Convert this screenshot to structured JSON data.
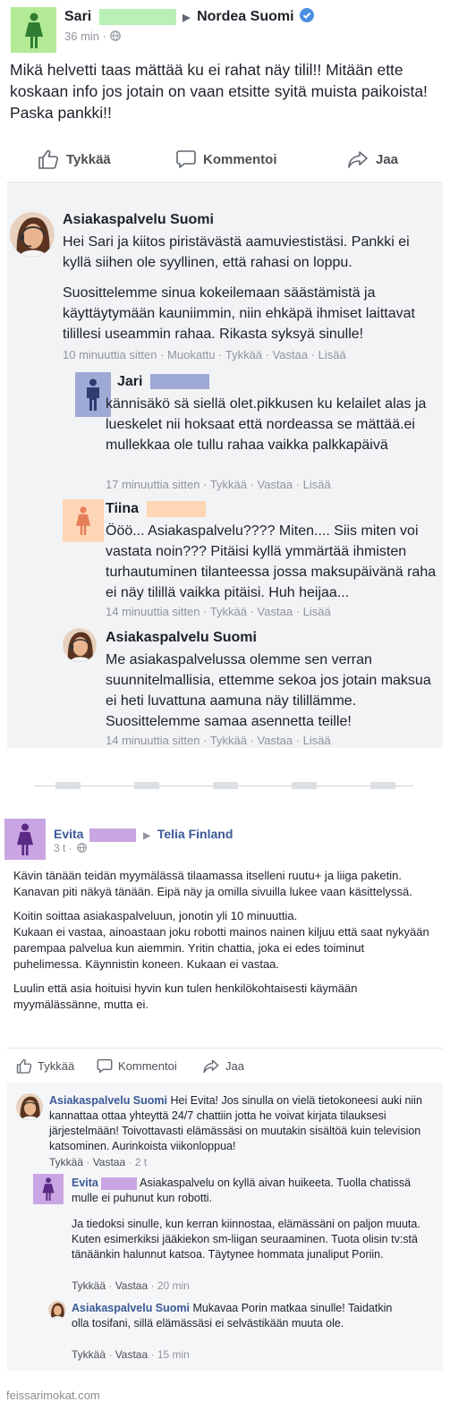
{
  "post1": {
    "author": "Sari",
    "page": "Nordea Suomi",
    "time": "36 min",
    "text": "Mikä helvetti taas mättää ku ei rahat näy tilil!! Mitään ette koskaan info jos jotain on vaan etsitte syitä muista paikoista! Paska pankki!!",
    "actions": {
      "like": "Tykkää",
      "comment": "Kommentoi",
      "share": "Jaa"
    },
    "comments": [
      {
        "author": "Asiakaspalvelu Suomi",
        "text1": "Hei Sari ja kiitos piristävästä aamuviestistäsi. Pankki ei kyllä siihen ole syyllinen, että rahasi on loppu.",
        "text2": "Suosittelemme sinua kokeilemaan säästämistä ja käyttäytymään kauniimmin, niin ehkäpä ihmiset laittavat tilillesi useammin rahaa. Rikasta syksyä sinulle!",
        "meta": "10 minuuttia sitten · Muokattu · Tykkää · Vastaa · Lisää"
      },
      {
        "author": "Jari",
        "text": "kännisäkö sä siellä olet.pikkusen ku kelailet alas ja lueskelet nii hoksaat että nordeassa se mättää.ei mullekkaa ole tullu rahaa vaikka palkkapäivä",
        "meta": "17 minuuttia sitten · Tykkää · Vastaa · Lisää"
      },
      {
        "author": "Tiina",
        "text": "Ööö... Asiakaspalvelu???? Miten.... Siis miten voi vastata noin??? Pitäisi kyllä ymmärtää ihmisten turhautuminen tilanteessa jossa maksupäivänä raha ei näy tilillä vaikka pitäisi. Huh heijaa...",
        "meta": "14 minuuttia sitten · Tykkää · Vastaa · Lisää"
      },
      {
        "author": "Asiakaspalvelu Suomi",
        "text": "Me asiakaspalvelussa olemme sen verran suunnitelmallisia, ettemme sekoa jos jotain maksua ei heti luvattuna aamuna näy tilillämme. Suosittelemme samaa asennetta teille!",
        "meta": "14 minuuttia sitten · Tykkää · Vastaa · Lisää"
      }
    ]
  },
  "post2": {
    "author": "Evita",
    "page": "Telia Finland",
    "time": "3 t ·",
    "paragraphs": [
      "Kävin tänään teidän myymälässä tilaamassa itselleni ruutu+ ja liiga paketin. Kanavan piti näkyä tänään. Eipä näy ja omilla sivuilla lukee vaan käsittelyssä.",
      "Koitin soittaa asiakaspalveluun, jonotin yli 10 minuuttia.\nKukaan ei vastaa, ainoastaan joku robotti mainos nainen kiljuu että saat nykyään parempaa palvelua kun aiemmin. Yritin chattia, joka ei edes toiminut puhelimessa. Käynnistin koneen. Kukaan ei vastaa.",
      "Luulin että asia hoituisi hyvin kun tulen henkilökohtaisesti käymään myymälässänne, mutta ei."
    ],
    "actions": {
      "like": "Tykkää",
      "comment": "Kommentoi",
      "share": "Jaa"
    },
    "comments": [
      {
        "author": "Asiakaspalvelu Suomi",
        "text": "Hei Evita! Jos sinulla on vielä tietokoneesi auki niin kannattaa ottaa yhteyttä 24/7 chattiin jotta he voivat kirjata tilauksesi järjestelmään! Toivottavasti elämässäsi on muutakin sisältöä kuin television katsominen. Aurinkoista viikonloppua!",
        "like": "Tykkää",
        "reply": "Vastaa",
        "time": "2 t"
      },
      {
        "author": "Evita",
        "text1": "Asiakaspalvelu on kyllä aivan huikeeta. Tuolla chatissä mulle ei puhunut kun robotti.",
        "text2": "Ja tiedoksi sinulle, kun kerran kiinnostaa, elämässäni on paljon muuta. Kuten esimerkiksi jääkiekon sm-liigan seuraaminen. Tuota olisin tv:stä tänäänkin halunnut katsoa. Täytynee hommata junaliput Poriin.",
        "like": "Tykkää",
        "reply": "Vastaa",
        "time": "20 min"
      },
      {
        "author": "Asiakaspalvelu Suomi",
        "text": "Mukavaa Porin matkaa sinulle! Taidatkin olla tosifani, sillä elämässäsi ei selvästikään muuta ole.",
        "like": "Tykkää",
        "reply": "Vastaa",
        "time": "15 min"
      }
    ]
  },
  "watermark": "feissarimokat.com",
  "colors": {
    "redact_green": "#b9f0b5",
    "redact_blue": "#9fa9d6",
    "redact_peach": "#fdd6b5",
    "redact_purple": "#c9a6e3",
    "link_blue": "#3b5998",
    "verified_blue": "#4a90e2"
  }
}
